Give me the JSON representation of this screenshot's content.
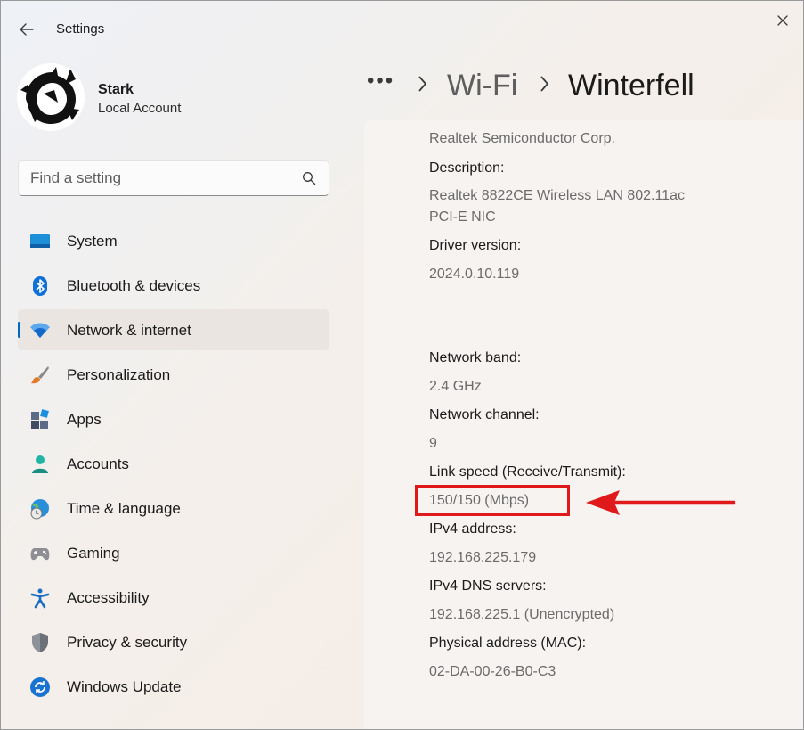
{
  "app": {
    "title": "Settings"
  },
  "profile": {
    "name": "Stark",
    "account_type": "Local Account"
  },
  "search": {
    "placeholder": "Find a setting"
  },
  "nav": {
    "items": [
      {
        "label": "System",
        "icon": "system-icon"
      },
      {
        "label": "Bluetooth & devices",
        "icon": "bluetooth-icon"
      },
      {
        "label": "Network & internet",
        "icon": "wifi-icon",
        "active": true
      },
      {
        "label": "Personalization",
        "icon": "brush-icon"
      },
      {
        "label": "Apps",
        "icon": "apps-icon"
      },
      {
        "label": "Accounts",
        "icon": "accounts-icon"
      },
      {
        "label": "Time & language",
        "icon": "globe-clock-icon"
      },
      {
        "label": "Gaming",
        "icon": "gamepad-icon"
      },
      {
        "label": "Accessibility",
        "icon": "accessibility-icon"
      },
      {
        "label": "Privacy & security",
        "icon": "shield-icon"
      },
      {
        "label": "Windows Update",
        "icon": "update-icon"
      }
    ]
  },
  "breadcrumb": {
    "more": "•••",
    "parent": "Wi-Fi",
    "current": "Winterfell"
  },
  "properties": {
    "manufacturer_value": "Realtek Semiconductor Corp.",
    "description_label": "Description:",
    "description_value_line1": "Realtek 8822CE Wireless LAN 802.11ac",
    "description_value_line2": "PCI-E NIC",
    "driver_label": "Driver version:",
    "driver_value": "2024.0.10.119",
    "band_label": "Network band:",
    "band_value": "2.4 GHz",
    "channel_label": "Network channel:",
    "channel_value": "9",
    "link_speed_label": "Link speed (Receive/Transmit):",
    "link_speed_value": "150/150 (Mbps)",
    "ipv4_label": "IPv4 address:",
    "ipv4_value": "192.168.225.179",
    "dns_label": "IPv4 DNS servers:",
    "dns_value": "192.168.225.1 (Unencrypted)",
    "mac_label": "Physical address (MAC):",
    "mac_value": "02-DA-00-26-B0-C3"
  },
  "colors": {
    "accent": "#0067c0",
    "annotation": "#e0191b"
  }
}
